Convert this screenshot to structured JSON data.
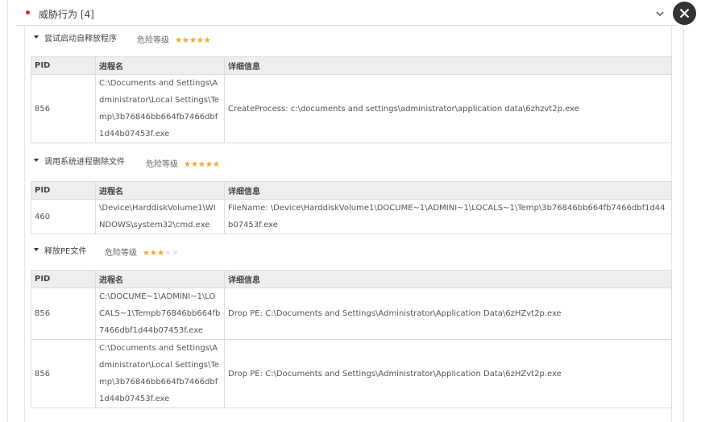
{
  "section": {
    "title": "威胁行为 [4]"
  },
  "risk_label": "危险等级",
  "headers": {
    "pid": "PID",
    "process": "进程名",
    "detail": "详细信息"
  },
  "behaviors": [
    {
      "title": "尝试启动自释放程序",
      "stars": 5,
      "rows": [
        {
          "pid": "856",
          "process": "C:\\Documents and Settings\\Administrator\\Local Settings\\Temp\\3b76846bb664fb7466dbf1d44b07453f.exe",
          "detail": "CreateProcess: c:\\documents and settings\\administrator\\application data\\6zhzvt2p.exe"
        }
      ]
    },
    {
      "title": "调用系统进程删除文件",
      "stars": 5,
      "rows": [
        {
          "pid": "460",
          "process": "\\Device\\HarddiskVolume1\\WINDOWS\\system32\\cmd.exe",
          "detail": "FileName: \\Device\\HarddiskVolume1\\DOCUME~1\\ADMINI~1\\LOCALS~1\\Temp\\3b76846bb664fb7466dbf1d44b07453f.exe"
        }
      ]
    },
    {
      "title": "释放PE文件",
      "stars": 3,
      "rows": [
        {
          "pid": "856",
          "process": "C:\\DOCUME~1\\ADMINI~1\\LOCALS~1\\Tempb76846bb664fb7466dbf1d44b07453f.exe",
          "detail": "Drop PE: C:\\Documents and Settings\\Administrator\\Application Data\\6zHZvt2p.exe"
        },
        {
          "pid": "856",
          "process": "C:\\Documents and Settings\\Administrator\\Local Settings\\Temp\\3b76846bb664fb7466dbf1d44b07453f.exe",
          "detail": "Drop PE: C:\\Documents and Settings\\Administrator\\Application Data\\6zHZvt2p.exe"
        }
      ]
    }
  ],
  "colors": {
    "star_on": "#f5a623",
    "star_off": "#e4e4e4",
    "dot": "#e02020",
    "header_bg": "#eeeeee"
  },
  "icons": {
    "close": "close-icon",
    "collapse": "chevron-down-icon",
    "expand_caret": "caret-down-icon"
  }
}
